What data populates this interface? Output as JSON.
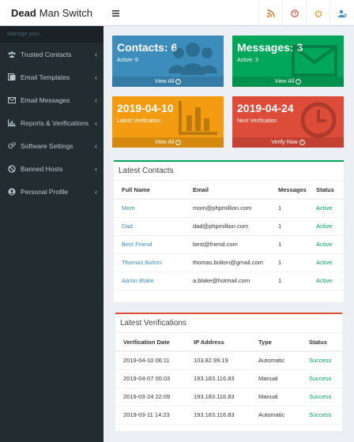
{
  "app": {
    "title_bold": "Dead",
    "title_rest": "Man Switch"
  },
  "header_icons": [
    "rss-icon",
    "help-icon",
    "power-icon",
    "user-settings-icon"
  ],
  "sidebar": {
    "header": "Manage your...",
    "items": [
      {
        "label": "Trusted Contacts",
        "icon": "users-icon"
      },
      {
        "label": "Email Templates",
        "icon": "template-icon"
      },
      {
        "label": "Email Messages",
        "icon": "envelope-icon"
      },
      {
        "label": "Reports & Verifications",
        "icon": "chart-icon"
      },
      {
        "label": "Software Settings",
        "icon": "cogs-icon"
      },
      {
        "label": "Banned Hosts",
        "icon": "ban-icon"
      },
      {
        "label": "Personal Profile",
        "icon": "profile-icon"
      }
    ]
  },
  "boxes": {
    "contacts": {
      "title": "Contacts: 6",
      "sub": "Active: 6",
      "footer": "View All",
      "color": "#3c8dbc"
    },
    "messages": {
      "title": "Messages: 3",
      "sub": "Active: 3",
      "footer": "View All",
      "color": "#00a65a"
    },
    "latest_verification": {
      "title": "2019-04-10",
      "sub": "Latest Verification",
      "footer": "View All",
      "color": "#f39c12"
    },
    "next_verification": {
      "title": "2019-04-24",
      "sub": "Next Verification",
      "footer": "Verify Now",
      "color": "#dd4b39"
    }
  },
  "latest_contacts": {
    "title": "Latest Contacts",
    "columns": [
      "Full Name",
      "Email",
      "Messages",
      "Status"
    ],
    "rows": [
      {
        "name": "Mom",
        "email": "mom@phpmillion.com",
        "messages": "1",
        "status": "Active"
      },
      {
        "name": "Dad",
        "email": "dad@phpmillion.com",
        "messages": "1",
        "status": "Active"
      },
      {
        "name": "Best Friend",
        "email": "best@friend.com",
        "messages": "1",
        "status": "Active"
      },
      {
        "name": "Thomas Bolton",
        "email": "thomas.bolton@gmail.com",
        "messages": "1",
        "status": "Active"
      },
      {
        "name": "Aaron Blake",
        "email": "a.blake@hotmail.com",
        "messages": "1",
        "status": "Active"
      }
    ]
  },
  "latest_verifications": {
    "title": "Latest Verifications",
    "columns": [
      "Verification Date",
      "IP Address",
      "Type",
      "Status"
    ],
    "rows": [
      {
        "date": "2019-04-10 06:11",
        "ip": "103.82.99.19",
        "type": "Automatic",
        "status": "Success"
      },
      {
        "date": "2019-04-07 00:03",
        "ip": "193.183.116.83",
        "type": "Manual",
        "status": "Success"
      },
      {
        "date": "2019-03-24 22:09",
        "ip": "193.183.116.83",
        "type": "Manual",
        "status": "Success"
      },
      {
        "date": "2019-03-11 14:23",
        "ip": "193.183.116.83",
        "type": "Automatic",
        "status": "Success"
      }
    ]
  },
  "colors": {
    "link": "#3c8dbc",
    "success": "#00a65a",
    "sidebar_bg": "#222d32",
    "contacts_panel_border": "#00a65a",
    "verifications_panel_border": "#dd4b39"
  }
}
